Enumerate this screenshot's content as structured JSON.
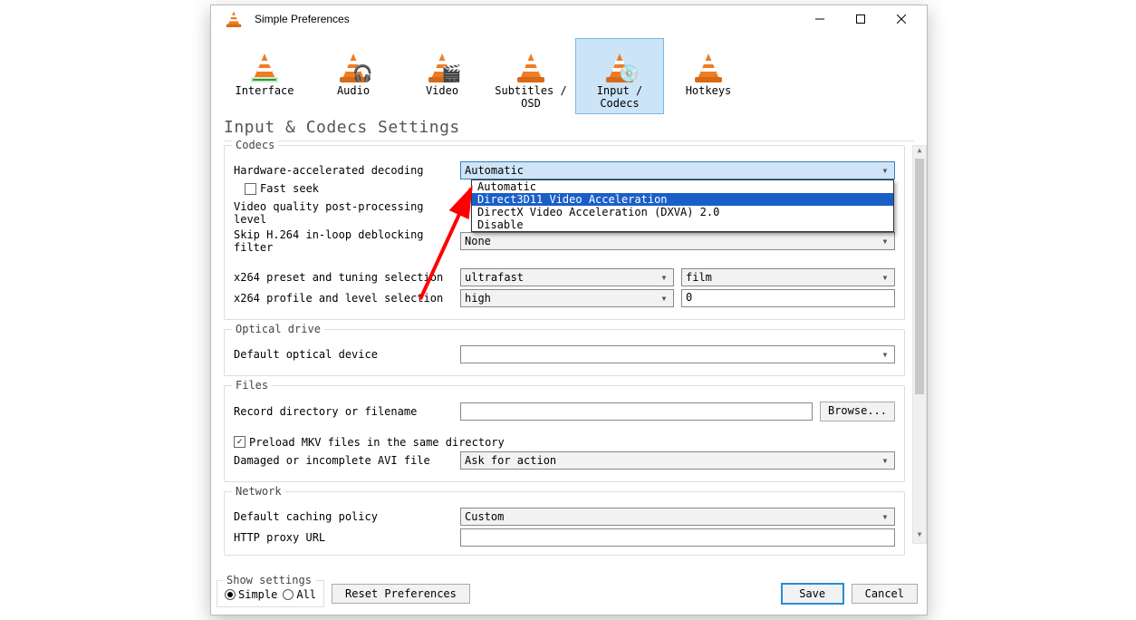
{
  "window": {
    "title": "Simple Preferences"
  },
  "tabs": {
    "interface": "Interface",
    "audio": "Audio",
    "video": "Video",
    "subtitles": "Subtitles / OSD",
    "input_codecs": "Input / Codecs",
    "hotkeys": "Hotkeys"
  },
  "section_title": "Input & Codecs Settings",
  "codecs": {
    "legend": "Codecs",
    "hw_decode_label": "Hardware-accelerated decoding",
    "hw_decode_value": "Automatic",
    "hw_decode_options": {
      "opt0": "Automatic",
      "opt1": "Direct3D11 Video Acceleration",
      "opt2": "DirectX Video Acceleration (DXVA) 2.0",
      "opt3": "Disable"
    },
    "fast_seek_label": "Fast seek",
    "fast_seek_checked": false,
    "postproc_label": "Video quality post-processing level",
    "skip_deblock_label": "Skip H.264 in-loop deblocking filter",
    "skip_deblock_value": "None",
    "x264_preset_label": "x264 preset and tuning selection",
    "x264_preset_value": "ultrafast",
    "x264_tune_value": "film",
    "x264_profile_label": "x264 profile and level selection",
    "x264_profile_value": "high",
    "x264_level_value": "0"
  },
  "optical": {
    "legend": "Optical drive",
    "default_device_label": "Default optical device",
    "default_device_value": ""
  },
  "files": {
    "legend": "Files",
    "record_label": "Record directory or filename",
    "record_value": "",
    "browse_label": "Browse...",
    "preload_mkv_label": "Preload MKV files in the same directory",
    "preload_mkv_checked": true,
    "avi_label": "Damaged or incomplete AVI file",
    "avi_value": "Ask for action"
  },
  "network": {
    "legend": "Network",
    "caching_label": "Default caching policy",
    "caching_value": "Custom",
    "proxy_label": "HTTP proxy URL",
    "proxy_value": ""
  },
  "footer": {
    "show_settings_legend": "Show settings",
    "simple_label": "Simple",
    "all_label": "All",
    "selected_mode": "Simple",
    "reset_label": "Reset Preferences",
    "save_label": "Save",
    "cancel_label": "Cancel"
  }
}
